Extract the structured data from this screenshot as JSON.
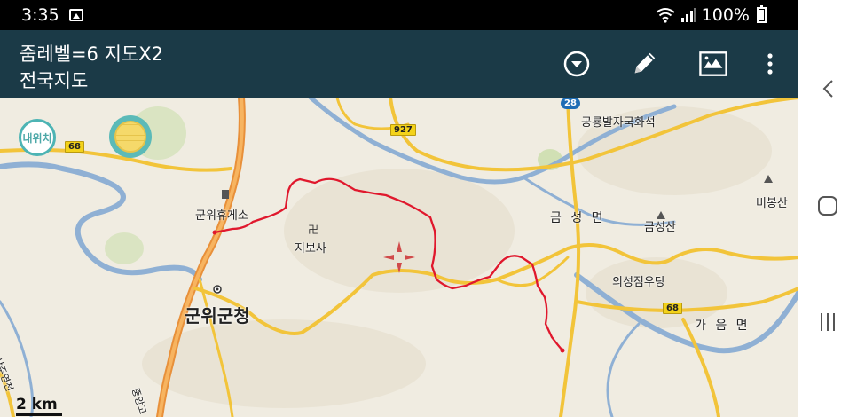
{
  "status_bar": {
    "time": "3:35",
    "battery_text": "100%",
    "icons": [
      "gallery-icon",
      "wifi-icon",
      "signal-icon",
      "battery-icon"
    ]
  },
  "app_bar": {
    "title_line1": "줌레벨=6 지도X2",
    "title_line2": "전국지도",
    "actions": [
      "dropdown-circle-icon",
      "pencil-icon",
      "map-layers-icon",
      "more-vert-icon"
    ]
  },
  "map": {
    "my_location_label": "내위치",
    "scale_label": "2 km",
    "labels": {
      "rest_area": "군위휴게소",
      "temple": "지보사",
      "county_office": "군위군청",
      "hwaseok": "공룡발자국화석",
      "geumseong_myeon": "금 성 면",
      "geumseongsan": "금성산",
      "bibongsan": "비봉산",
      "uiseong_store": "의성점우당",
      "gaeum_myeon": "가 음 면",
      "expressway": "중앙고",
      "sangju_road": "상주영천"
    },
    "route_badges": {
      "r68_left": "68",
      "r927": "927",
      "r28": "28",
      "r68_right": "68"
    },
    "colors": {
      "land": "#f0ece1",
      "river": "#8fb0d4",
      "road": "#f2c43a",
      "expressway": "#e8903a",
      "track": "#e0182d",
      "forest": "#cfe3b0",
      "header": "#1b3a47"
    }
  },
  "nav_bar": {
    "buttons": [
      "back-icon",
      "home-icon",
      "recents-icon"
    ]
  }
}
